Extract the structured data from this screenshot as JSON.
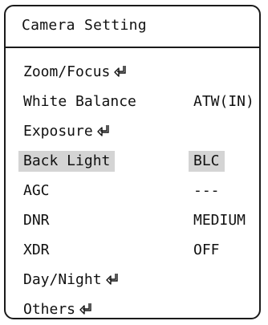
{
  "menu": {
    "title": "Camera Setting",
    "items": [
      {
        "label": "Zoom/Focus",
        "value": "",
        "submenu": true,
        "icon": "enter-arrow-icon"
      },
      {
        "label": "White Balance",
        "value": "ATW(IN)",
        "submenu": false
      },
      {
        "label": "Exposure",
        "value": "",
        "submenu": true,
        "icon": "enter-arrow-icon"
      },
      {
        "label": "Back Light",
        "value": "BLC",
        "submenu": false,
        "selected": true
      },
      {
        "label": "AGC",
        "value": "---",
        "submenu": false
      },
      {
        "label": "DNR",
        "value": "MEDIUM",
        "submenu": false
      },
      {
        "label": "XDR",
        "value": "OFF",
        "submenu": false
      },
      {
        "label": "Day/Night",
        "value": "",
        "submenu": true,
        "icon": "enter-arrow-icon"
      },
      {
        "label": "Others",
        "value": "",
        "submenu": true,
        "icon": "enter-arrow-icon"
      }
    ]
  },
  "colors": {
    "highlight": "#d4d4d4",
    "border": "#1a1a1a",
    "text": "#111111",
    "background": "#ffffff"
  }
}
